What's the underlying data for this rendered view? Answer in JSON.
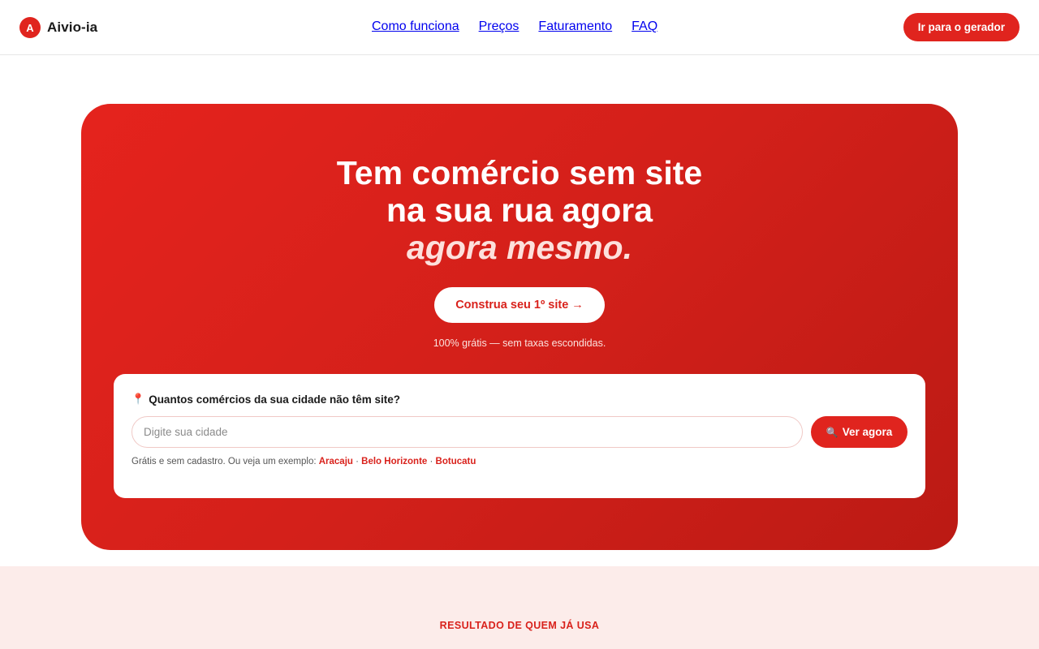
{
  "brand": {
    "logo_letter": "A",
    "name": "Aivio-ia"
  },
  "nav": {
    "items": [
      {
        "label": "Como funciona"
      },
      {
        "label": "Preços"
      },
      {
        "label": "Faturamento"
      },
      {
        "label": "FAQ"
      }
    ],
    "cta_label": "Ir para o gerador"
  },
  "hero": {
    "title_line1": "Tem comércio sem site",
    "title_line2": "na sua rua agora",
    "title_accent": "agora mesmo.",
    "cta_label": "Construa seu 1º site →",
    "note": "100% grátis — sem taxas escondidas."
  },
  "search": {
    "question": "Quantos comércios da sua cidade não têm site?",
    "pin_icon": "📍",
    "input_placeholder": "Digite sua cidade",
    "input_value": "",
    "button_icon": "🔍",
    "button_label": "Ver agora",
    "examples_prefix": "Grátis e sem cadastro. Ou veja um exemplo:",
    "examples": [
      "Aracaju",
      "Belo Horizonte",
      "Botucatu"
    ],
    "separator": " · "
  },
  "results": {
    "label": "RESULTADO DE QUEM JÁ USA"
  },
  "colors": {
    "accent": "#e0241e",
    "accent_dark": "#bb1a14",
    "soft_bg": "#fcecea"
  }
}
